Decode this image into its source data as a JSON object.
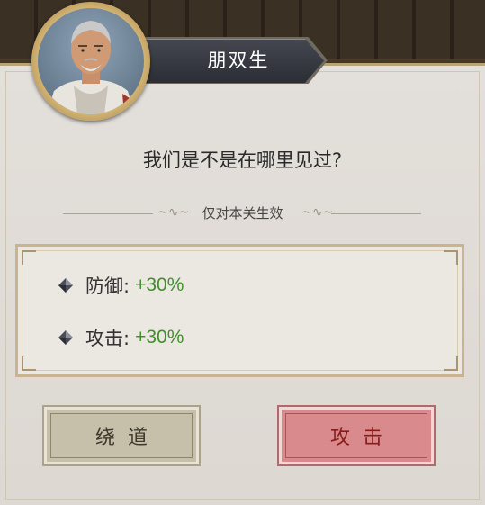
{
  "npc": {
    "name": "朋双生",
    "portrait_icon": "npc-portrait"
  },
  "dialogue": "我们是不是在哪里见过?",
  "divider_label": "仅对本关生效",
  "buffs": [
    {
      "label": "防御:",
      "value": "+30%",
      "icon": "gem-icon"
    },
    {
      "label": "攻击:",
      "value": "+30%",
      "icon": "gem-icon"
    }
  ],
  "buttons": {
    "detour": "绕道",
    "attack": "攻击"
  },
  "colors": {
    "buff_value": "#3f8f2a",
    "attack_button": "#d98a8c",
    "detour_button": "#c6c0ab"
  }
}
